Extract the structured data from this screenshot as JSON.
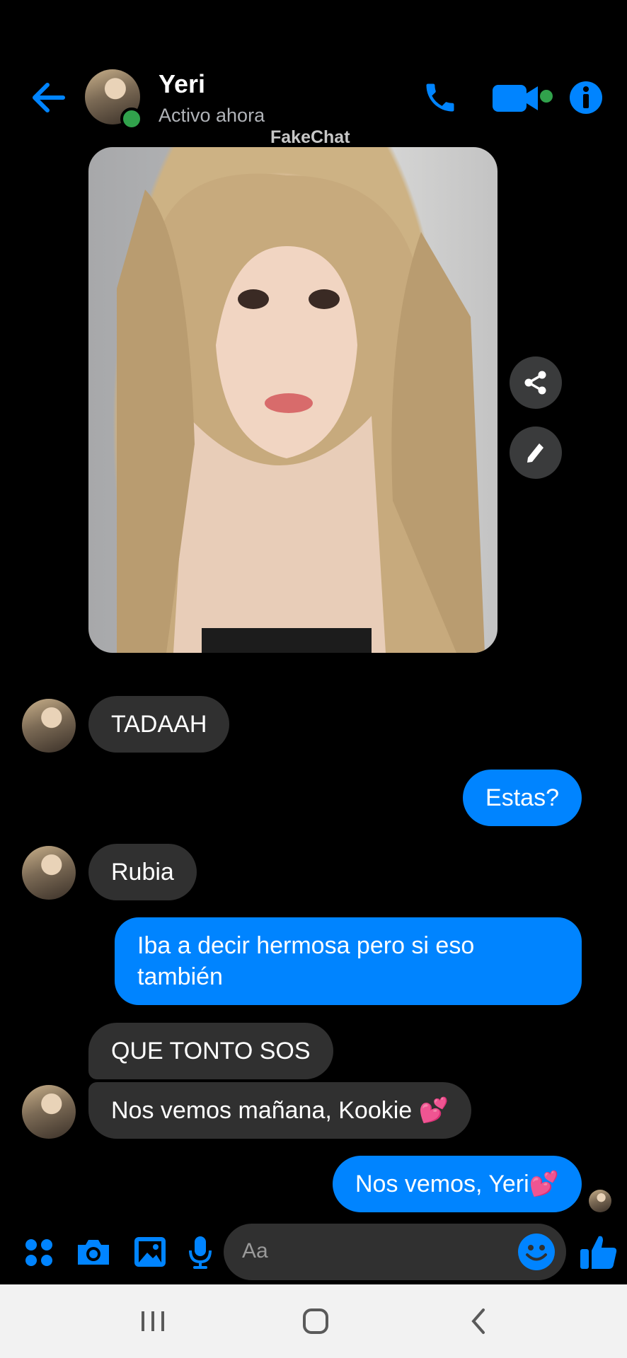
{
  "header": {
    "contact_name": "Yeri",
    "status": "Activo ahora",
    "watermark": "FakeChat",
    "icons": [
      "back-arrow-icon",
      "phone-icon",
      "video-camera-icon",
      "info-icon"
    ],
    "accent_color": "#0084ff"
  },
  "photo_actions": [
    "share-icon",
    "edit-pencil-icon"
  ],
  "messages": [
    {
      "from": "contact",
      "text": "TADAAH"
    },
    {
      "from": "me",
      "text": "Estas?"
    },
    {
      "from": "contact",
      "text": "Rubia"
    },
    {
      "from": "me",
      "text": "Iba a decir hermosa pero si eso también"
    },
    {
      "from": "contact",
      "text": "QUE TONTO SOS"
    },
    {
      "from": "contact",
      "text": "Nos vemos mañana, Kookie 💕"
    },
    {
      "from": "me",
      "text": "Nos vemos, Yeri💕"
    }
  ],
  "composer": {
    "placeholder": "Aa",
    "icons": [
      "apps-grid-icon",
      "camera-icon",
      "gallery-icon",
      "microphone-icon",
      "emoji-icon",
      "thumbs-up-icon"
    ]
  },
  "nav": [
    "recent-apps-icon",
    "home-icon",
    "back-icon"
  ]
}
